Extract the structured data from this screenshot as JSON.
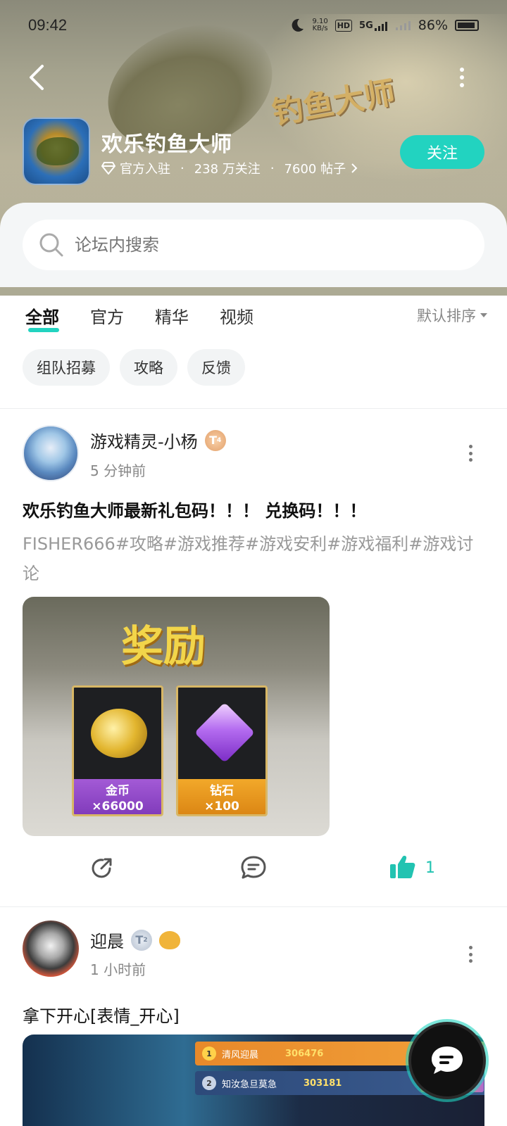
{
  "status_bar": {
    "time": "09:42",
    "net_speed_top": "9.10",
    "net_speed_unit": "KB/s",
    "hd_label": "HD",
    "signal_label": "5G",
    "battery": "86%"
  },
  "header": {
    "game_name": "欢乐钓鱼大师",
    "banner_logo_text": "钓鱼大师",
    "official_label": "官方入驻",
    "followers": "238 万关注",
    "posts": "7600 帖子",
    "follow_button": "关注"
  },
  "search": {
    "placeholder": "论坛内搜索"
  },
  "tabs": [
    {
      "label": "全部",
      "active": true
    },
    {
      "label": "官方",
      "active": false
    },
    {
      "label": "精华",
      "active": false
    },
    {
      "label": "视频",
      "active": false
    }
  ],
  "sort_label": "默认排序",
  "chips": [
    "组队招募",
    "攻略",
    "反馈"
  ],
  "posts": [
    {
      "author": "游戏精灵-小杨",
      "badge": "T",
      "badge_level": "4",
      "time": "5 分钟前",
      "title": "欢乐钓鱼大师最新礼包码！！！ 兑换码！！！",
      "body": "FISHER666#攻略#游戏推荐#游戏安利#游戏福利#游戏讨论",
      "image": {
        "heading": "奖励",
        "rewards": [
          {
            "name": "金币",
            "amount": "×66000"
          },
          {
            "name": "钻石",
            "amount": "×100"
          }
        ]
      },
      "likes": "1"
    },
    {
      "author": "迎晨",
      "badge": "T",
      "badge_level": "2",
      "time": "1 小时前",
      "title": "拿下开心[表情_开心]",
      "image": {
        "rows": [
          {
            "rank": "1",
            "name": "清风迎晨",
            "score": "306476"
          },
          {
            "rank": "2",
            "name": "知汝急旦莫急",
            "score": "303181"
          }
        ]
      }
    }
  ],
  "colors": {
    "accent": "#22d3c0",
    "text_primary": "#222222",
    "text_secondary": "#888888"
  }
}
